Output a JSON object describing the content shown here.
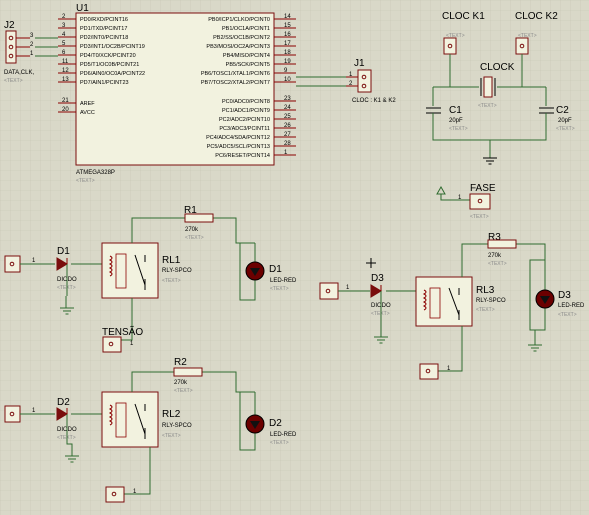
{
  "schematic": {
    "mcu": {
      "ref": "U1",
      "part": "ATMEGA328P",
      "text": "<TEXT>",
      "left_pins": [
        {
          "num": "2",
          "name": "PD0/RXD/PCINT16"
        },
        {
          "num": "3",
          "name": "PD1/TXD/PCINT17"
        },
        {
          "num": "4",
          "name": "PD2/INT0/PCINT18"
        },
        {
          "num": "5",
          "name": "PD3/INT1/OC2B/PCINT19"
        },
        {
          "num": "6",
          "name": "PD4/T0/XCK/PCINT20"
        },
        {
          "num": "11",
          "name": "PD5/T1/OC0B/PCINT21"
        },
        {
          "num": "12",
          "name": "PD6/AIN0/OC0A/PCINT22"
        },
        {
          "num": "13",
          "name": "PD7/AIN1/PCINT23"
        },
        {
          "num": "21",
          "name": "AREF"
        },
        {
          "num": "20",
          "name": "AVCC"
        }
      ],
      "right_pins": [
        {
          "num": "14",
          "name": "PB0/ICP1/CLKO/PCINT0"
        },
        {
          "num": "15",
          "name": "PB1/OC1A/PCINT1"
        },
        {
          "num": "16",
          "name": "PB2/SS/OC1B/PCINT2"
        },
        {
          "num": "17",
          "name": "PB3/MOSI/OC2A/PCINT3"
        },
        {
          "num": "18",
          "name": "PB4/MISO/PCINT4"
        },
        {
          "num": "19",
          "name": "PB5/SCK/PCINT5"
        },
        {
          "num": "9",
          "name": "PB6/TOSC1/XTAL1/PCINT6"
        },
        {
          "num": "10",
          "name": "PB7/TOSC2/XTAL2/PCINT7"
        },
        {
          "num": "23",
          "name": "PC0/ADC0/PCINT8"
        },
        {
          "num": "24",
          "name": "PC1/ADC1/PCINT9"
        },
        {
          "num": "25",
          "name": "PC2/ADC2/PCINT10"
        },
        {
          "num": "26",
          "name": "PC3/ADC3/PCINT11"
        },
        {
          "num": "27",
          "name": "PC4/ADC4/SDA/PCINT12"
        },
        {
          "num": "28",
          "name": "PC5/ADC5/SCL/PCINT13"
        },
        {
          "num": "1",
          "name": "PC6/RESET/PCINT14"
        }
      ]
    },
    "j2": {
      "ref": "J2",
      "label": "DATA,CLK,",
      "text": "<TEXT>",
      "pins": [
        "3",
        "2",
        "1"
      ]
    },
    "j1": {
      "ref": "J1",
      "label": "CLOC : K1 & K2",
      "pins": [
        "1",
        "2"
      ]
    },
    "cloc_k1": {
      "ref": "CLOC K1",
      "text": "<TEXT>"
    },
    "cloc_k2": {
      "ref": "CLOC K2",
      "text": "<TEXT>"
    },
    "crystal": {
      "ref": "CLOCK",
      "text": "<TEXT>"
    },
    "c1": {
      "ref": "C1",
      "value": "20pF",
      "text": "<TEXT>"
    },
    "c2": {
      "ref": "C2",
      "value": "20pF",
      "text": "<TEXT>"
    },
    "fase": {
      "ref": "FASE",
      "text": "<TEXT>",
      "pin": "1"
    },
    "tensao": {
      "ref": "TENSÃO",
      "pin": "1"
    },
    "r1": {
      "ref": "R1",
      "value": "270k",
      "text": "<TEXT>"
    },
    "r2": {
      "ref": "R2",
      "value": "270k",
      "text": "<TEXT>"
    },
    "r3": {
      "ref": "R3",
      "value": "270k",
      "text": "<TEXT>"
    },
    "d1": {
      "ref": "D1",
      "part": "DIODO",
      "text": "<TEXT>"
    },
    "d2": {
      "ref": "D2",
      "part": "DIODO",
      "text": "<TEXT>"
    },
    "d3": {
      "ref": "D3",
      "part": "DIODO",
      "text": "<TEXT>"
    },
    "led1": {
      "ref": "D1",
      "part": "LED-RED",
      "text": "<TEXT>"
    },
    "led2": {
      "ref": "D2",
      "part": "LED-RED",
      "text": "<TEXT>"
    },
    "led3": {
      "ref": "D3",
      "part": "LED-RED",
      "text": "<TEXT>"
    },
    "rl1": {
      "ref": "RL1",
      "part": "RLY-SPCO",
      "text": "<TEXT>"
    },
    "rl2": {
      "ref": "RL2",
      "part": "RLY-SPCO",
      "text": "<TEXT>"
    },
    "rl3": {
      "ref": "RL3",
      "part": "RLY-SPCO",
      "text": "<TEXT>"
    },
    "port_pin": "1",
    "colors": {
      "background": "#d9d8c8",
      "grid": "#c7c6b4",
      "body_fill": "#f2f2df",
      "body_stroke": "#7a0d0d",
      "wire": "#2f6b2f",
      "led": "#6b0000",
      "text_hint": "#8a8a8a"
    }
  }
}
